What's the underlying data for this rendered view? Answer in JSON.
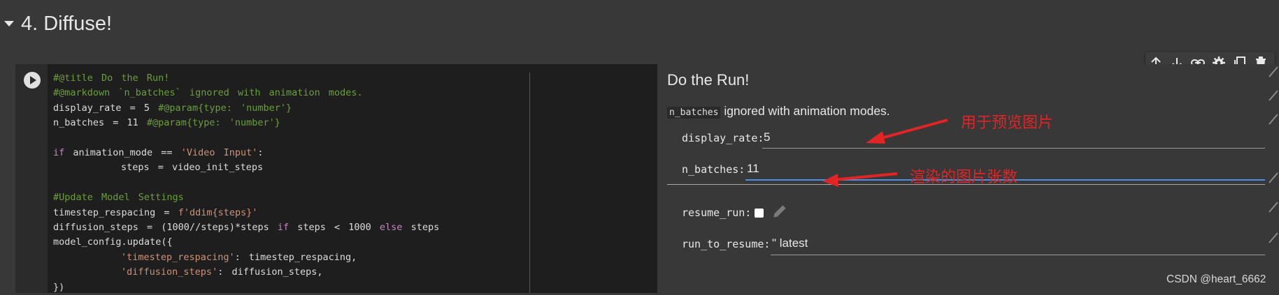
{
  "section": {
    "title": "4. Diffuse!"
  },
  "code": {
    "line1": "#@title Do the Run!",
    "line2": "#@markdown `n_batches` ignored with animation modes.",
    "line3a": "display_rate = 5 ",
    "line3b": "#@param{type: 'number'}",
    "line4a": "n_batches = 11 ",
    "line4b": "#@param{type: 'number'}",
    "line6a": "if",
    "line6b": " animation_mode == ",
    "line6c": "'Video Input'",
    "line6d": ":",
    "line7": "        steps = video_init_steps",
    "line9": "#Update Model Settings",
    "line10a": "timestep_respacing = ",
    "line10b": "f'ddim{steps}'",
    "line11a": "diffusion_steps = (1000//steps)*steps ",
    "line11b": "if",
    "line11c": " steps < 1000 ",
    "line11d": "else",
    "line11e": " steps",
    "line12": "model_config.update({",
    "line13a": "        'timestep_respacing'",
    "line13b": ": timestep_respacing,",
    "line14a": "        'diffusion_steps'",
    "line14b": ": diffusion_steps,",
    "line15": "})"
  },
  "form": {
    "title": "Do the Run!",
    "markdown_code": "n_batches",
    "markdown_text": " ignored with animation modes.",
    "display_rate_label": "display_rate:",
    "display_rate_value": "5",
    "n_batches_label": "n_batches:",
    "n_batches_value": "11",
    "resume_run_label": "resume_run:",
    "run_to_resume_label": "run_to_resume:",
    "run_to_resume_value": "\" latest"
  },
  "annotations": {
    "preview": "用于预览图片",
    "count": "渲染的图片张数",
    "color": "#e22424"
  },
  "toolbar": {
    "icons": [
      "arrow-up-icon",
      "arrow-down-icon",
      "link-icon",
      "gear-icon",
      "copy-icon",
      "trash-icon"
    ]
  },
  "watermark": "CSDN @heart_6662"
}
